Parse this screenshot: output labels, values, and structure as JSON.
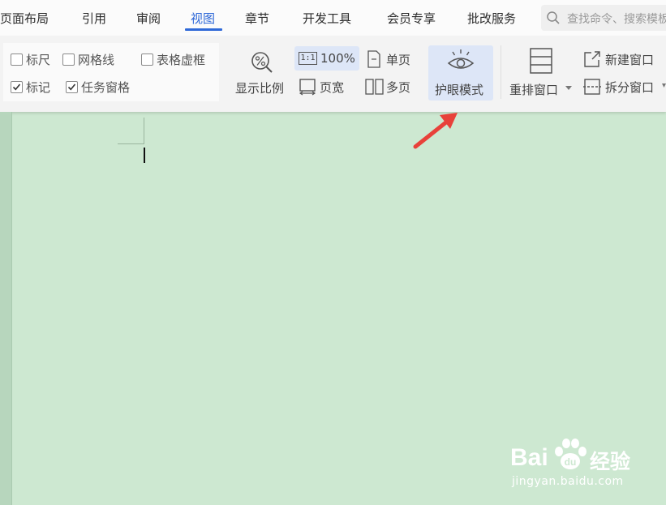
{
  "menu": {
    "items": [
      "页面布局",
      "引用",
      "审阅",
      "视图",
      "章节",
      "开发工具",
      "会员专享",
      "批改服务"
    ],
    "active": "视图",
    "accent_color": "#2f69d8"
  },
  "search": {
    "placeholder": "查找命令、搜索模板"
  },
  "toolbar": {
    "checkboxes": [
      {
        "label": "标尺",
        "checked": false
      },
      {
        "label": "网格线",
        "checked": false
      },
      {
        "label": "表格虚框",
        "checked": false
      },
      {
        "label": "标记",
        "checked": true
      },
      {
        "label": "任务窗格",
        "checked": true
      }
    ],
    "zoom_button": "显示比例",
    "zoom_100": "100%",
    "zoom_100_icon_text": "1:1",
    "page_width": "页宽",
    "single_page": "单页",
    "multi_page": "多页",
    "eye_mode": "护眼模式",
    "rearrange_windows": "重排窗口",
    "new_window": "新建窗口",
    "split_window": "拆分窗口"
  },
  "document": {
    "background_color": "#cde8d1"
  },
  "watermark": {
    "brand_left": "Bai",
    "brand_right": "经验",
    "url": "jingyan.baidu.com"
  }
}
